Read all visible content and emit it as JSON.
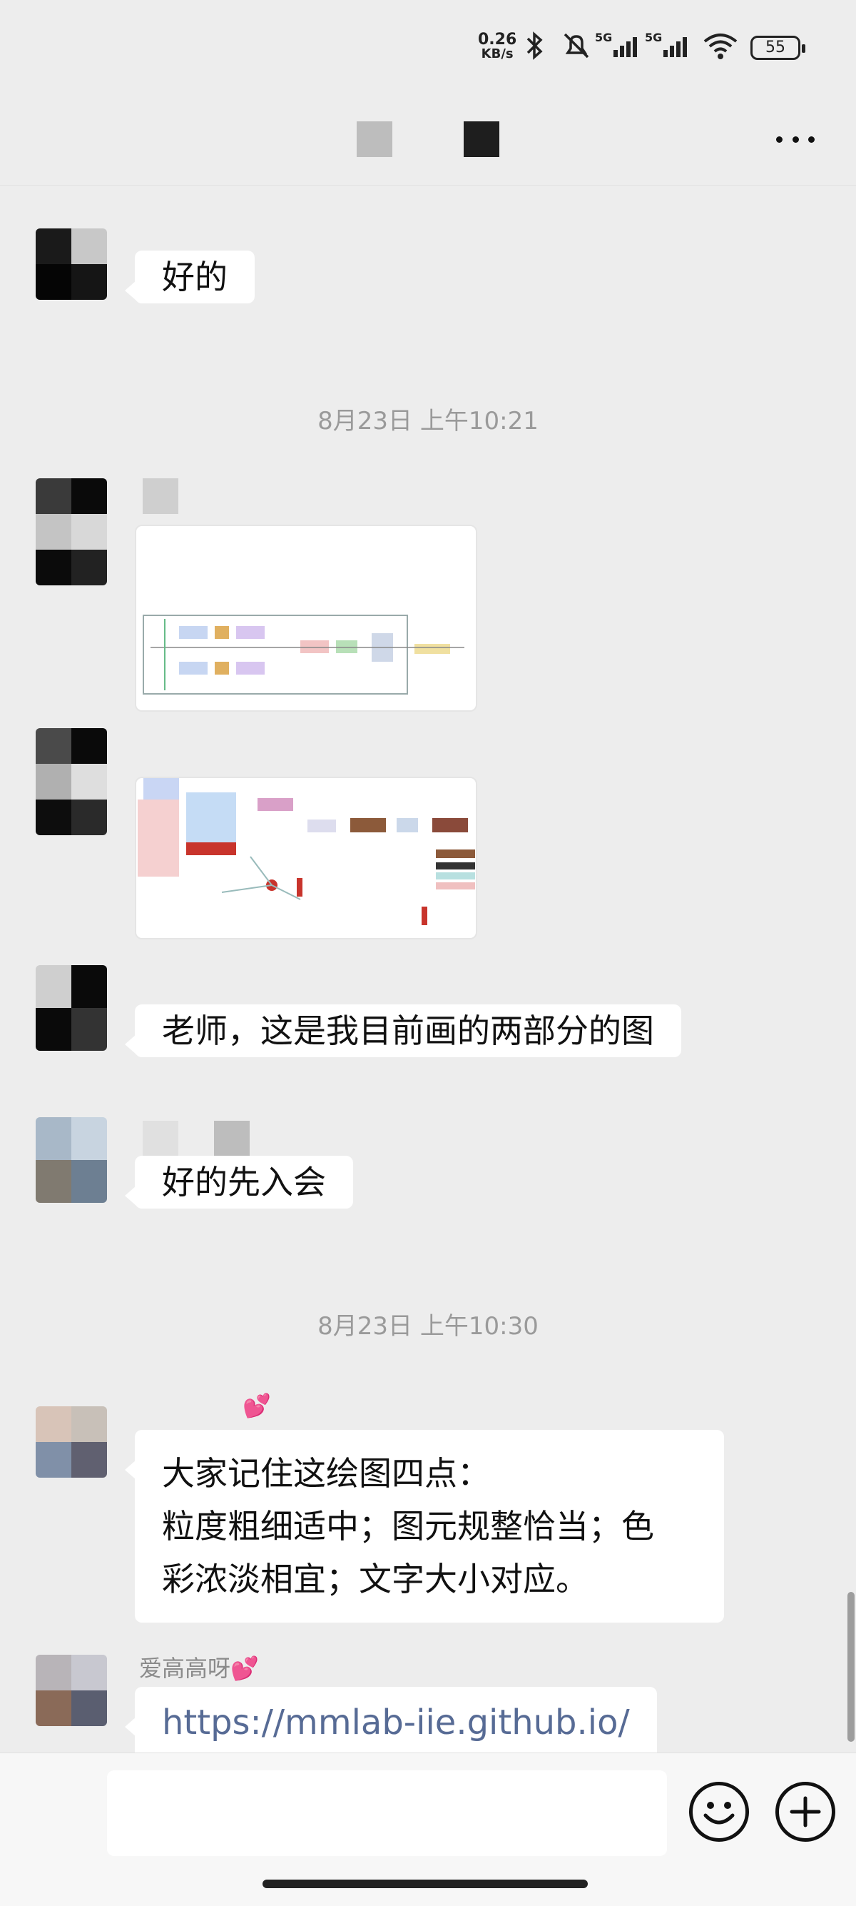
{
  "status_bar": {
    "net_speed_value": "0.26",
    "net_speed_unit": "KB/s",
    "signal1": "5G",
    "signal2": "5G",
    "battery": "55"
  },
  "chat": {
    "timestamps": [
      "8月23日 上午10:21",
      "8月23日 上午10:30"
    ],
    "messages": [
      {
        "type": "text",
        "text": "好的"
      },
      {
        "type": "image",
        "alt": "diagram-1"
      },
      {
        "type": "image",
        "alt": "diagram-2"
      },
      {
        "type": "text",
        "text": "老师，这是我目前画的两部分的图"
      },
      {
        "type": "text",
        "text": "好的先入会"
      },
      {
        "type": "text",
        "lines": [
          "大家记住这绘图四点：",
          "粒度粗细适中；图元规整恰当；色",
          "彩浓淡相宜；文字大小对应。"
        ]
      },
      {
        "type": "link",
        "sender": "爱高高呀💕",
        "text": "https://mmlab-iie.github.io/"
      }
    ]
  }
}
